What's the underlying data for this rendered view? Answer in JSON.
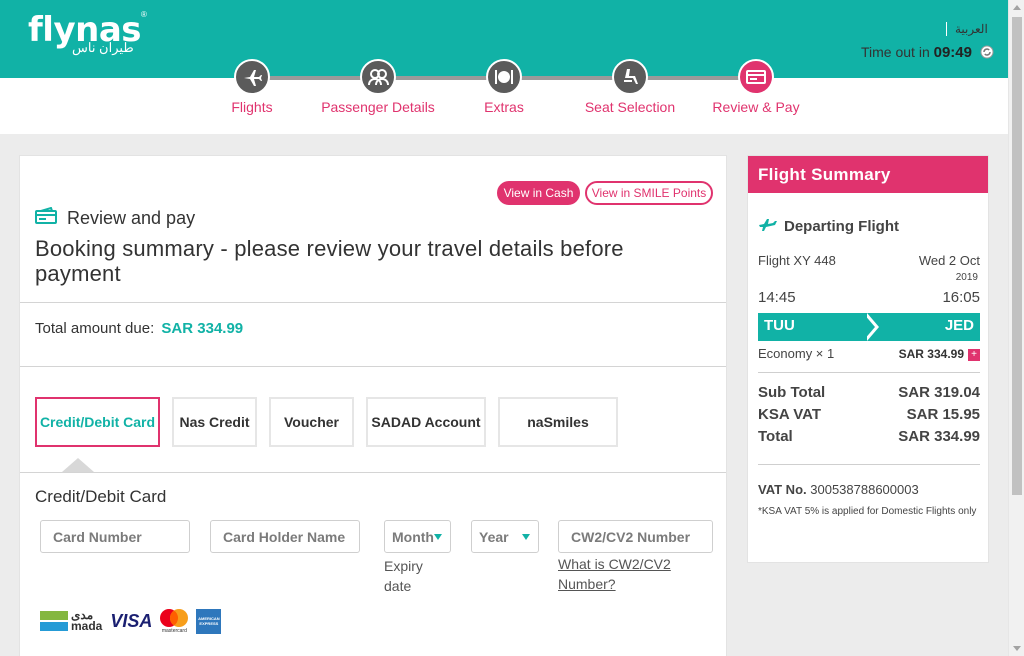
{
  "header": {
    "logo_text": "flynas",
    "logo_reg": "®",
    "logo_arabic": "طيران ناس",
    "language_link": "العربية",
    "timeout_label": "Time out in",
    "timeout_value": "09:49"
  },
  "steps": [
    {
      "label": "Flights",
      "icon": "plane-icon"
    },
    {
      "label": "Passenger Details",
      "icon": "passengers-icon"
    },
    {
      "label": "Extras",
      "icon": "meal-icon"
    },
    {
      "label": "Seat Selection",
      "icon": "seat-icon"
    },
    {
      "label": "Review & Pay",
      "icon": "ticket-icon",
      "active": true
    }
  ],
  "main": {
    "view_cash": "View in Cash",
    "view_smile": "View in SMILE Points",
    "review_title": "Review and pay",
    "booking_summary": "Booking summary - please review your travel details before payment",
    "total_label": "Total amount due:",
    "total_value": "SAR 334.99",
    "payment_tabs": [
      "Credit/Debit Card",
      "Nas Credit",
      "Voucher",
      "SADAD Account",
      "naSmiles"
    ],
    "active_tab": 0,
    "card_section_title": "Credit/Debit Card",
    "fields": {
      "card_number": "Card Number",
      "holder_name": "Card Holder Name",
      "month": "Month",
      "year": "Year",
      "cvv": "CW2/CV2 Number"
    },
    "expiry_label": "Expiry date",
    "cvv_help": "What is CW2/CV2 Number?",
    "card_logos": {
      "mada_ar": "مدى",
      "mada_en": "mada",
      "visa": "VISA",
      "mastercard": "mastercard",
      "amex": "AMERICAN EXPRESS"
    }
  },
  "summary": {
    "title": "Flight Summary",
    "departing_label": "Departing Flight",
    "flight_no": "Flight XY 448",
    "date": "Wed 2 Oct",
    "year": "2019",
    "depart_time": "14:45",
    "arrive_time": "16:05",
    "from": "TUU",
    "to": "JED",
    "fare_class": "Economy × 1",
    "fare_price": "SAR 334.99",
    "subtotal_label": "Sub Total",
    "subtotal_value": "SAR 319.04",
    "vat_label": "KSA VAT",
    "vat_value": "SAR 15.95",
    "total_label": "Total",
    "total_value": "SAR 334.99",
    "vat_no_label": "VAT No.",
    "vat_no_value": "300538788600003",
    "vat_note": "*KSA VAT 5% is applied for Domestic Flights only"
  },
  "colors": {
    "teal": "#11b2a6",
    "pink": "#e0336e",
    "step_grey": "#5b5b5b"
  }
}
